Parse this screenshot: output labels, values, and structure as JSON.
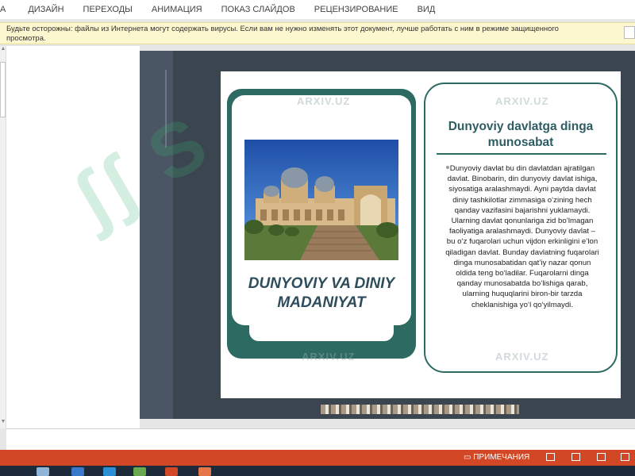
{
  "ribbon": {
    "tabs": [
      "А",
      "ДИЗАЙН",
      "ПЕРЕХОДЫ",
      "АНИМАЦИЯ",
      "ПОКАЗ СЛАЙДОВ",
      "РЕЦЕНЗИРОВАНИЕ",
      "ВИД"
    ]
  },
  "protected_view": {
    "message": "Будьте осторожны: файлы из Интернета могут содержать вирусы. Если вам не нужно изменять этот документ, лучше работать с ним в режиме защищенного просмотра."
  },
  "slide": {
    "main_title": "DUNYOVIY VA DINIY MADANIYAT",
    "right_title": "Dunyoviy davlatga dinga munosabat",
    "right_body": "Dunyoviy davlat bu din davlatdan ajratilgan davlat. Binobarin, din dunyoviy davlat ishiga, siyosatiga aralashmaydi. Ayni paytda davlat diniy tashkilotlar zimmasiga o‘zining hech qanday vazifasini bajarishni yuklamaydi. Ularning davlat qonunlariga zid bo‘lmagan faoliyatiga aralashmaydi. Dunyoviy davlat – bu o‘z fuqarolari uchun vijdon erkinligini e’lon qiladigan davlat. Bunday davlatning fuqarolari dinga munosabatidan qat’iy nazar qonun oldida teng bo‘ladilar. Fuqarolarni dinga qanday munosabatda bo‘lishiga qarab, ularning huquqlarini biron-bir tarzda cheklanishiga yo‘l qo‘yilmaydi.",
    "watermark": "ARXIV.UZ"
  },
  "status_bar": {
    "notes_label": "ПРИМЕЧАНИЯ"
  }
}
